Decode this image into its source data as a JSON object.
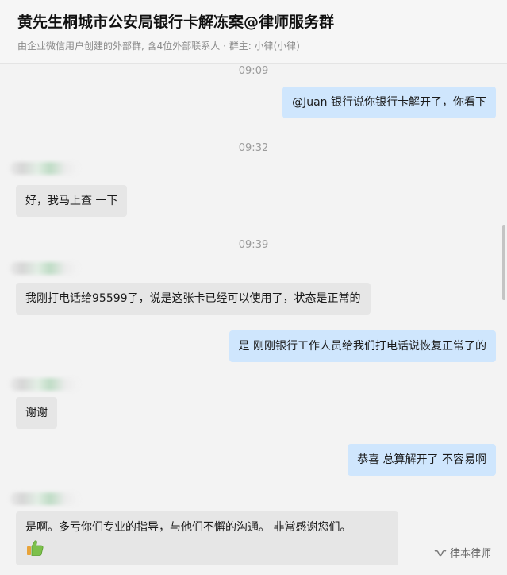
{
  "header": {
    "title": "黄先生桐城市公安局银行卡解冻案@律师服务群",
    "subtitle": "由企业微信用户创建的外部群, 含4位外部联系人 · 群主: 小律(小律)"
  },
  "messages": [
    {
      "time": "09:09"
    },
    {
      "dir": "out",
      "text": "@Juan 银行说你银行卡解开了，你看下"
    },
    {
      "time": "09:32"
    },
    {
      "dir": "in",
      "text": "好，我马上查 一下"
    },
    {
      "time": "09:39"
    },
    {
      "dir": "in",
      "text": "我刚打电话给95599了，说是这张卡已经可以使用了，状态是正常的"
    },
    {
      "dir": "out",
      "text": "是 刚刚银行工作人员给我们打电话说恢复正常了的"
    },
    {
      "dir": "in",
      "text": "谢谢"
    },
    {
      "dir": "out",
      "text": "恭喜  总算解开了 不容易啊"
    },
    {
      "dir": "in",
      "text": "是啊。多亏你们专业的指导，与他们不懈的沟通。 非常感谢您们。",
      "emoji": "thumbs-up-icon"
    }
  ],
  "watermark": {
    "text": "律本律师",
    "icon": "wechat-channel-icon"
  }
}
